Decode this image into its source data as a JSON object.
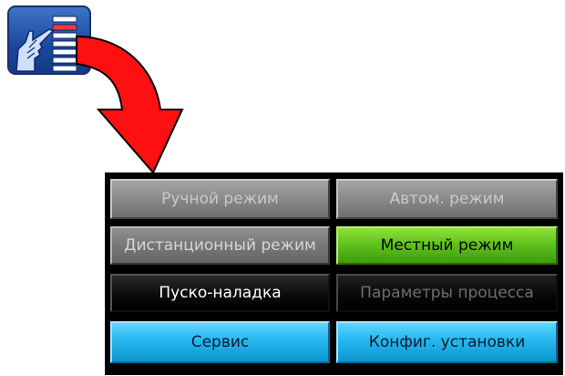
{
  "colors": {
    "panel_bg": "#000000",
    "gray_button": "#8c8c8c",
    "green_button": "#61c21c",
    "black_button": "#0a0a0a",
    "cyan_button": "#25b7ef",
    "arrow": "#ff0000",
    "icon_bg": "#1c4aa0"
  },
  "icons": {
    "app_icon": "hand-pointing-menu-icon",
    "arrow": "curved-down-arrow-icon"
  },
  "buttons": {
    "manual_mode": "Ручной режим",
    "auto_mode": "Автом. режим",
    "remote_mode": "Дистанционный режим",
    "local_mode": "Местный режим",
    "commissioning": "Пуско-наладка",
    "process_params": "Параметры процесса",
    "service": "Сервис",
    "unit_config": "Конфиг. установки"
  }
}
